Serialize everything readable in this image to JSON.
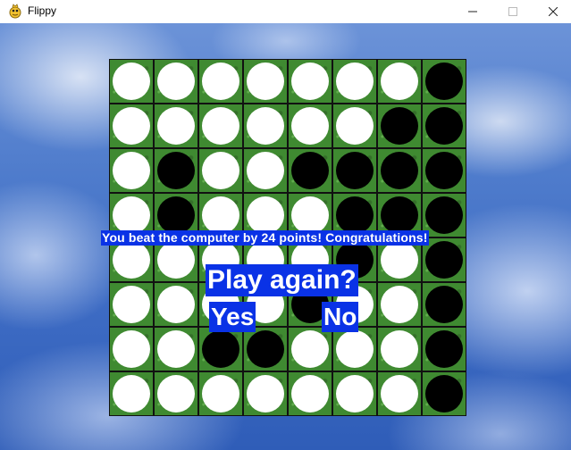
{
  "window": {
    "title": "Flippy"
  },
  "colors": {
    "banner_bg": "#0a32e6",
    "banner_text": "#ffffff",
    "tile_white": "#ffffff",
    "tile_black": "#000000",
    "board_green": "#3f8a31"
  },
  "board": {
    "size": 8,
    "rows": [
      [
        "W",
        "W",
        "W",
        "W",
        "W",
        "W",
        "W",
        "B"
      ],
      [
        "W",
        "W",
        "W",
        "W",
        "W",
        "W",
        "B",
        "B"
      ],
      [
        "W",
        "B",
        "W",
        "W",
        "B",
        "B",
        "B",
        "B"
      ],
      [
        "W",
        "B",
        "W",
        "W",
        "W",
        "B",
        "B",
        "B"
      ],
      [
        "W",
        "W",
        "W",
        "W",
        "W",
        "B",
        "W",
        "B"
      ],
      [
        "W",
        "W",
        "W",
        "W",
        "B",
        "W",
        "W",
        "B"
      ],
      [
        "W",
        "W",
        "B",
        "B",
        "W",
        "W",
        "W",
        "B"
      ],
      [
        "W",
        "W",
        "W",
        "W",
        "W",
        "W",
        "W",
        "B"
      ]
    ]
  },
  "messages": {
    "result": "You beat the computer by 24 points! Congratulations!",
    "play_again": "Play again?",
    "yes_label": "Yes",
    "no_label": "No"
  }
}
